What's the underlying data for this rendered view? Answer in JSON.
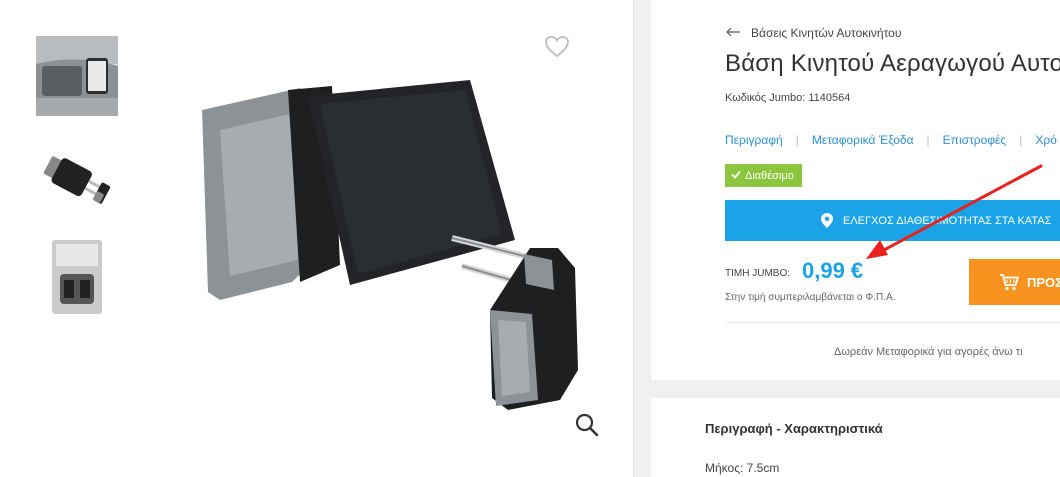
{
  "breadcrumb": {
    "label": "Βάσεις Κινητών Αυτοκινήτου"
  },
  "product": {
    "title": "Βάση Κινητού Αεραγωγού Αυτοκ",
    "sku": "Κωδικός Jumbo: 1140564",
    "availability": "Διαθέσιμο"
  },
  "tabs": [
    "Περιγραφή",
    "Μεταφορικά Έξοδα",
    "Επιστροφές",
    "Χρό"
  ],
  "store_check": {
    "label": "ΕΛΕΓΧΟΣ ΔΙΑΘΕΣΙΜΟΤΗΤΑΣ ΣΤΑ ΚΑΤΑΣ"
  },
  "price": {
    "label": "ΤΙΜΗ JUMBO:",
    "value": "0,99 €",
    "vat_note": "Στην τιμή συμπεριλαμβάνεται ο Φ.Π.Α."
  },
  "cart": {
    "label": "ΠΡΟΣ"
  },
  "shipping_note": "Δωρεάν Μεταφορικά για αγορές άνω τι",
  "description": {
    "title": "Περιγραφή - Χαρακτηριστικά",
    "length": "Μήκος: 7.5cm"
  },
  "colors": {
    "accent_blue": "#1aa3e6",
    "available_green": "#8cc63f",
    "cart_orange": "#f7931e",
    "annotation_red": "#e8211c"
  }
}
